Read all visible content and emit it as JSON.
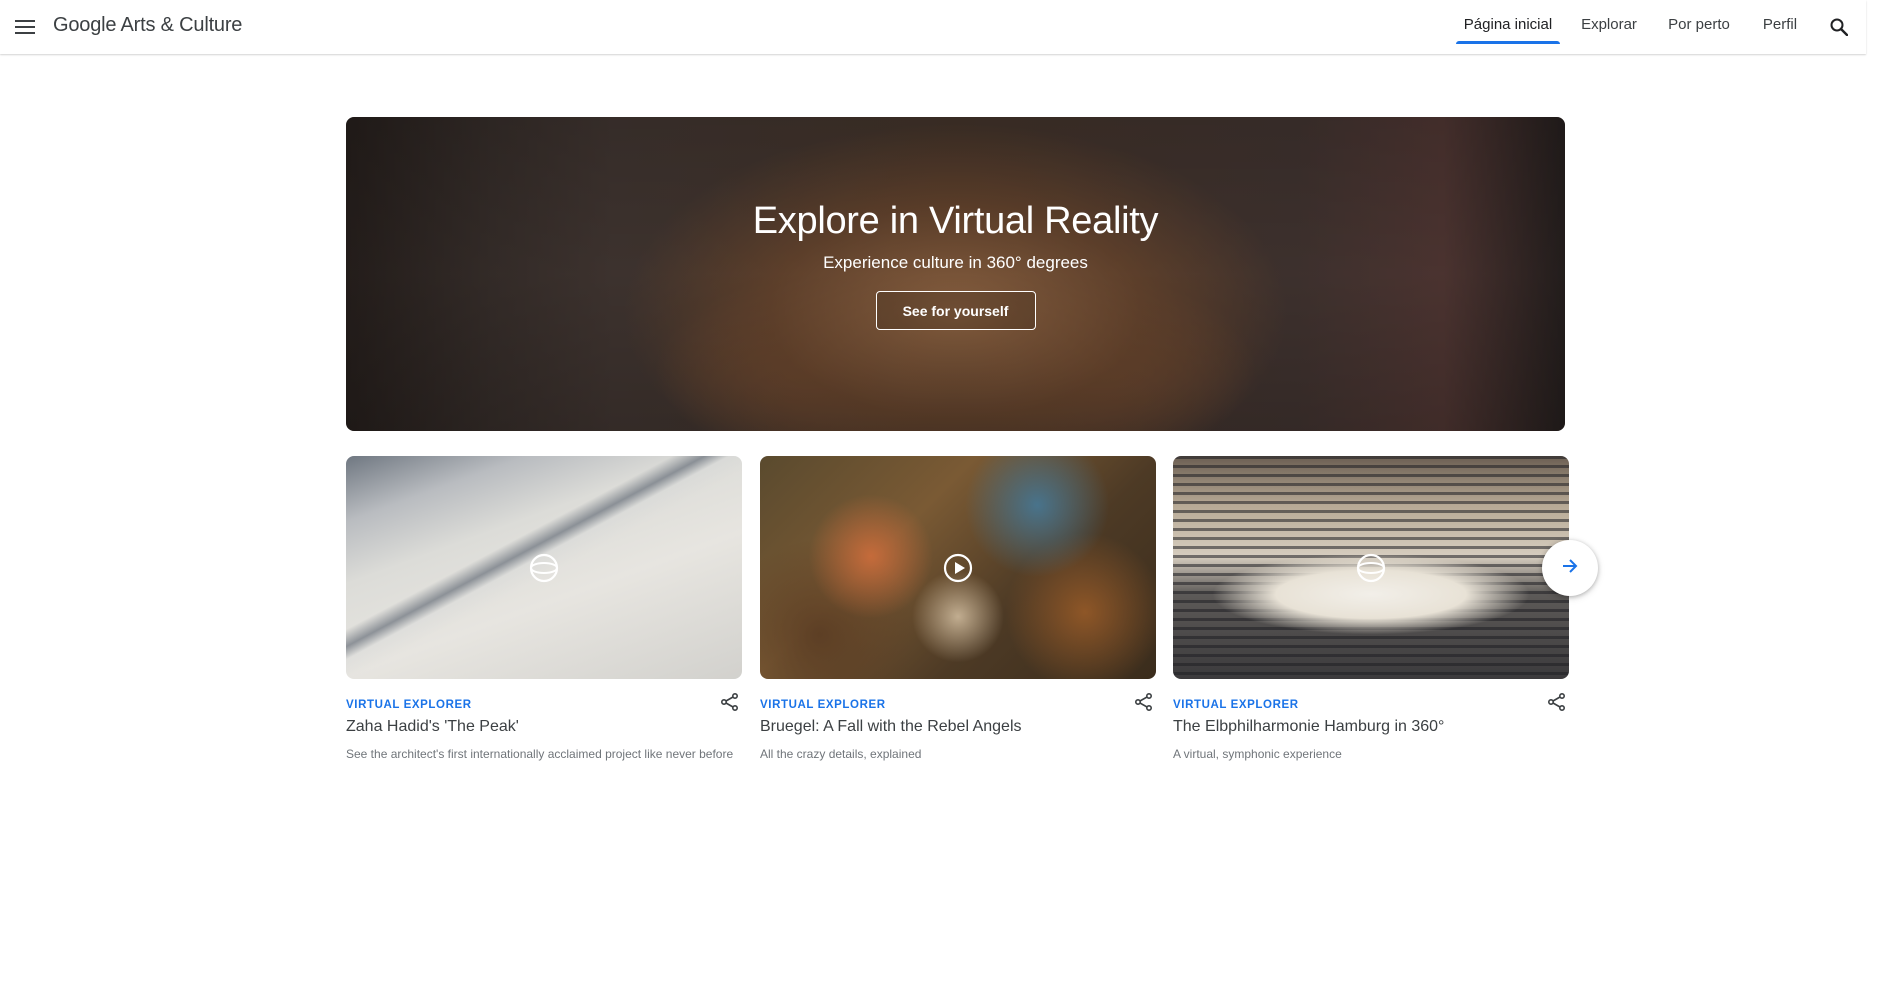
{
  "header": {
    "menu_icon": "menu-icon",
    "logo": "Google Arts & Culture",
    "nav": [
      {
        "label": "Página inicial",
        "active": true
      },
      {
        "label": "Explorar",
        "active": false
      },
      {
        "label": "Por perto",
        "active": false
      },
      {
        "label": "Perfil",
        "active": false
      }
    ],
    "search_icon": "search-icon"
  },
  "hero": {
    "title": "Explore in Virtual Reality",
    "subtitle": "Experience culture in 360° degrees",
    "button": "See for yourself"
  },
  "cards": [
    {
      "category": "VIRTUAL EXPLORER",
      "title": "Zaha Hadid's 'The Peak'",
      "description": "See the architect's first internationally acclaimed project like never before",
      "overlay_icon": "360-view-icon"
    },
    {
      "category": "VIRTUAL EXPLORER",
      "title": "Bruegel: A Fall with the Rebel Angels",
      "description": "All the crazy details, explained",
      "overlay_icon": "play-icon"
    },
    {
      "category": "VIRTUAL EXPLORER",
      "title": "The Elbphilharmonie Hamburg in 360°",
      "description": "A virtual, symphonic experience",
      "overlay_icon": "360-view-icon"
    }
  ],
  "carousel": {
    "next_icon": "arrow-right-icon"
  },
  "colors": {
    "accent": "#1a73e8",
    "text": "#3c4043",
    "muted": "#70757a"
  }
}
